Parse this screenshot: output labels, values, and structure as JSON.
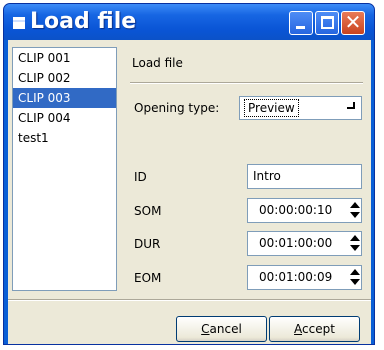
{
  "window": {
    "title": "Load file"
  },
  "clip_list": {
    "items": [
      "CLIP 001",
      "CLIP 002",
      "CLIP 003",
      "CLIP 004",
      "test1"
    ],
    "selected_index": 2
  },
  "panel": {
    "title": "Load file",
    "opening_type_label": "Opening type:",
    "opening_type_value": "Preview",
    "id_label": "ID",
    "id_value": "Intro",
    "som_label": "SOM",
    "som_value": "00:00:00:10",
    "dur_label": "DUR",
    "dur_value": "00:01:00:00",
    "eom_label": "EOM",
    "eom_value": "00:01:00:09"
  },
  "buttons": {
    "cancel_mnemonic": "C",
    "cancel_rest": "ancel",
    "accept_mnemonic": "A",
    "accept_rest": "ccept"
  },
  "colors": {
    "titlebar": "#0a5fd6",
    "selection": "#316ac5",
    "dialog_bg": "#ece9d8"
  },
  "icons": {
    "window": "window-icon",
    "minimize": "minimize-icon",
    "maximize": "maximize-icon",
    "close": "close-icon",
    "combo_arrow": "chevron-down-icon",
    "spin_up": "spin-up-icon",
    "spin_down": "spin-down-icon"
  }
}
